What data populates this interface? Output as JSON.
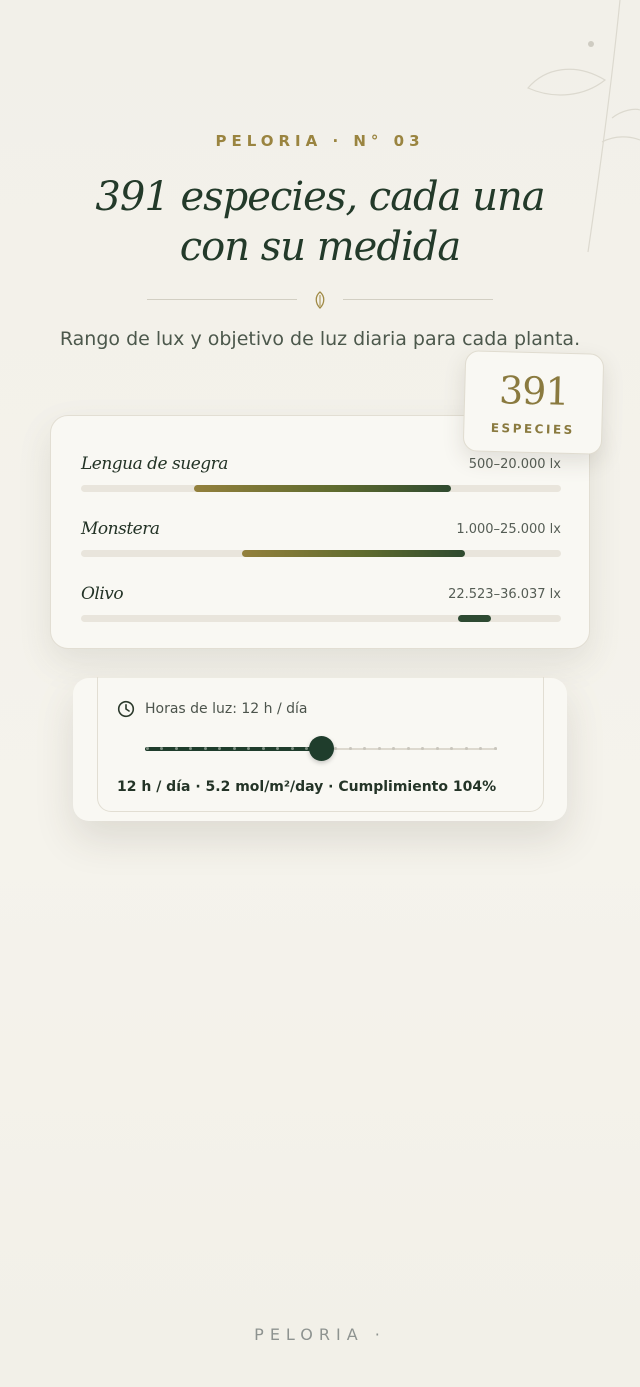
{
  "header": {
    "eyebrow": "PELORIA · N° 03",
    "headline_line1": "391 especies, cada una",
    "headline_line2": "con su medida",
    "subtitle": "Rango de lux y objetivo de luz diaria para cada planta."
  },
  "badge": {
    "count": "391",
    "label": "ESPECIES"
  },
  "plants": [
    {
      "name": "Lengua de suegra",
      "lux": "500–20.000 lx",
      "range_start": 0.235,
      "range_end": 0.77
    },
    {
      "name": "Monstera",
      "lux": "1.000–25.000 lx",
      "range_start": 0.335,
      "range_end": 0.8
    },
    {
      "name": "Olivo",
      "lux": "22.523–36.037 lx",
      "range_start": 0.785,
      "range_end": 0.855
    }
  ],
  "hours": {
    "label": "Horas de luz: 12 h / día",
    "value": 12,
    "min": 0,
    "max": 24,
    "summary": "12 h / día · 5.2 mol/m²/day · Cumplimiento 104%"
  },
  "footer": {
    "brand": "PELORIA ·"
  },
  "colors": {
    "accent_gold": "#9a8440",
    "forest": "#1f3d2c",
    "background": "#f2f0e9"
  },
  "icons": [
    "leaf-icon",
    "clock-icon",
    "botanical-branch-icon"
  ]
}
